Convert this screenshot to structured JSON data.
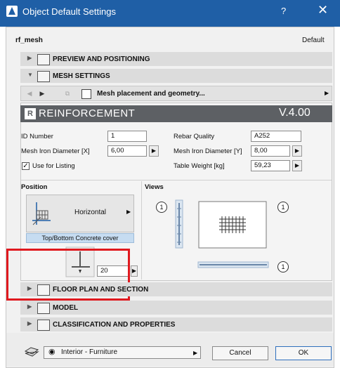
{
  "window": {
    "title": "Object Default Settings",
    "help_label": "?",
    "close_label": "✕"
  },
  "object": {
    "name": "rf_mesh",
    "status": "Default"
  },
  "sections": {
    "preview": "PREVIEW AND POSITIONING",
    "mesh": "MESH SETTINGS",
    "floor_plan": "FLOOR PLAN AND SECTION",
    "model": "MODEL",
    "classification": "CLASSIFICATION AND PROPERTIES"
  },
  "page_nav": {
    "current_page": "Mesh placement and geometry..."
  },
  "reinforcement": {
    "logo_text": "R",
    "title": "REINFORCEMENT",
    "version": "V.4.00",
    "id_number_label": "ID Number",
    "id_number_value": "1",
    "rebar_quality_label": "Rebar Quality",
    "rebar_quality_value": "A252",
    "mesh_dia_x_label": "Mesh Iron Diameter [X]",
    "mesh_dia_x_value": "6,00",
    "mesh_dia_y_label": "Mesh Iron Diameter [Y]",
    "mesh_dia_y_value": "8,00",
    "use_listing_label": "Use for Listing",
    "use_listing_checked": true,
    "table_weight_label": "Table Weight [kg]",
    "table_weight_value": "59,23"
  },
  "position": {
    "header": "Position",
    "orientation": "Horizontal",
    "cover_label": "Top/Bottom Concrete cover",
    "cover_value": "20"
  },
  "views": {
    "header": "Views",
    "marker": "1"
  },
  "footer": {
    "layer": "Interior - Furniture",
    "cancel_label": "Cancel",
    "ok_label": "OK"
  },
  "colors": {
    "titlebar": "#1f5fa6",
    "header_dark": "#5d6064",
    "highlight_red": "#e0191f",
    "selection_blue": "#c6dcf1"
  }
}
